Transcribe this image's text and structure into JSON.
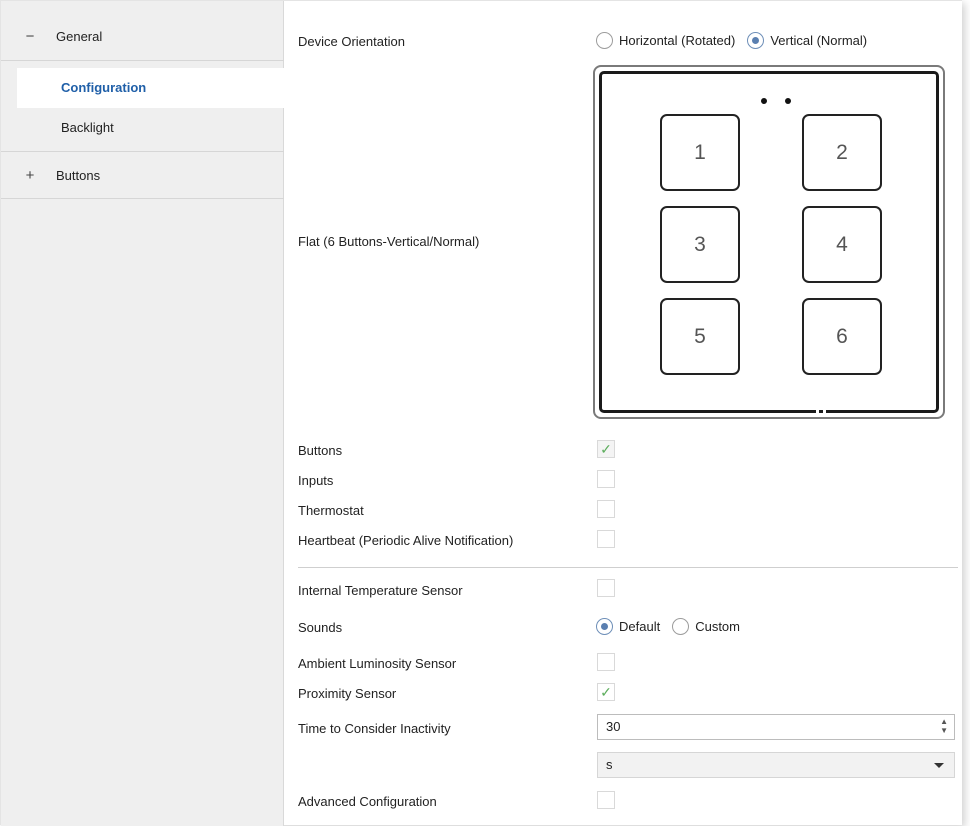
{
  "sidebar": {
    "general": {
      "sign": "−",
      "label": "General"
    },
    "items": [
      {
        "label": "Configuration",
        "active": true
      },
      {
        "label": "Backlight",
        "active": false
      }
    ],
    "buttons": {
      "sign": "+",
      "label": "Buttons"
    }
  },
  "main": {
    "orientation": {
      "label": "Device Orientation",
      "options": [
        {
          "label": "Horizontal (Rotated)",
          "selected": false
        },
        {
          "label": "Vertical (Normal)",
          "selected": true
        }
      ]
    },
    "device": {
      "label": "Flat (6 Buttons-Vertical/Normal)",
      "buttons": [
        "1",
        "2",
        "3",
        "4",
        "5",
        "6"
      ]
    },
    "checks": {
      "buttons": {
        "label": "Buttons",
        "checked": true,
        "mark": "✓"
      },
      "inputs": {
        "label": "Inputs",
        "checked": false
      },
      "thermostat": {
        "label": "Thermostat",
        "checked": false
      },
      "heartbeat": {
        "label": "Heartbeat (Periodic Alive Notification)",
        "checked": false
      },
      "internal_temp": {
        "label": "Internal Temperature Sensor",
        "checked": false
      },
      "ambient": {
        "label": "Ambient Luminosity Sensor",
        "checked": false
      },
      "proximity": {
        "label": "Proximity Sensor",
        "checked": true,
        "mark": "✓"
      },
      "advanced": {
        "label": "Advanced Configuration",
        "checked": false
      }
    },
    "sounds": {
      "label": "Sounds",
      "options": [
        {
          "label": "Default",
          "selected": true
        },
        {
          "label": "Custom",
          "selected": false
        }
      ]
    },
    "inactivity": {
      "label": "Time to Consider Inactivity",
      "value": "30",
      "unit": "s"
    }
  },
  "colors": {
    "accent": "#1f5fa8",
    "check": "#5cad5c",
    "sidebar_bg": "#efefef"
  }
}
